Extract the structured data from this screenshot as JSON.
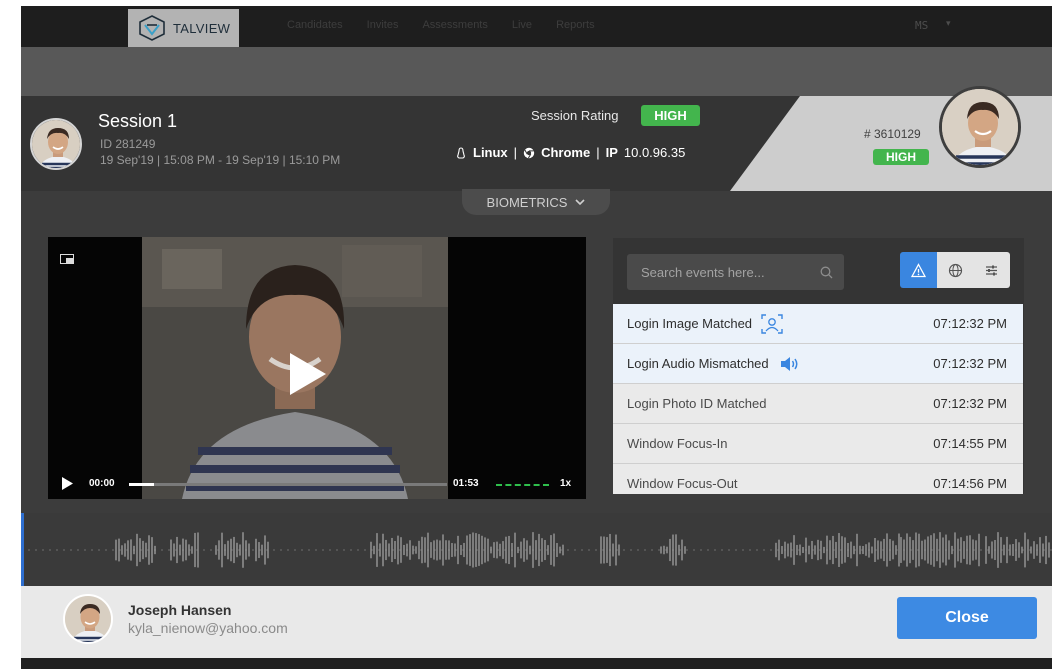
{
  "nav": {
    "logo_text": "TALVIEW",
    "links": [
      "Candidates",
      "Invites",
      "Assessments",
      "Live",
      "Reports"
    ],
    "user_initials": "MS",
    "user_caret": "▾"
  },
  "session": {
    "title": "Session 1",
    "id_text": "ID 281249",
    "time_range": "19 Sep'19 | 15:08 PM - 19 Sep'19 | 15:10 PM",
    "rating_label": "Session Rating",
    "rating_value": "HIGH",
    "os": "Linux",
    "sep": "|",
    "browser": "Chrome",
    "ip_label": "IP",
    "ip_value": "10.0.96.35",
    "biometrics_label": "BIOMETRICS"
  },
  "candidate": {
    "number": "# 3610129",
    "rating": "HIGH"
  },
  "video": {
    "current_time": "00:00",
    "duration": "01:53",
    "speed": "1x",
    "progress": 0.08
  },
  "events": {
    "search_placeholder": "Search events here...",
    "filters": [
      "warning-filter",
      "web-filter",
      "settings-filter"
    ],
    "active_filter": "warning-filter",
    "rows": [
      {
        "label": "Login Image Matched",
        "time": "07:12:32 PM",
        "icon": "face-scan-icon",
        "highlighted": true
      },
      {
        "label": "Login Audio Mismatched",
        "time": "07:12:32 PM",
        "icon": "speaker-icon",
        "highlighted": true
      },
      {
        "label": "Login Photo ID Matched",
        "time": "07:12:32 PM",
        "icon": "",
        "highlighted": false
      },
      {
        "label": "Window Focus-In",
        "time": "07:14:55 PM",
        "icon": "",
        "highlighted": false
      },
      {
        "label": "Window Focus-Out",
        "time": "07:14:56 PM",
        "icon": "",
        "highlighted": false
      }
    ]
  },
  "footer": {
    "name": "Joseph Hansen",
    "email": "kyla_nienow@yahoo.com",
    "close_label": "Close"
  },
  "colors": {
    "accent_blue": "#3d8ae3",
    "badge_green": "#43b54d",
    "dark_bg": "#3c3c3c"
  }
}
